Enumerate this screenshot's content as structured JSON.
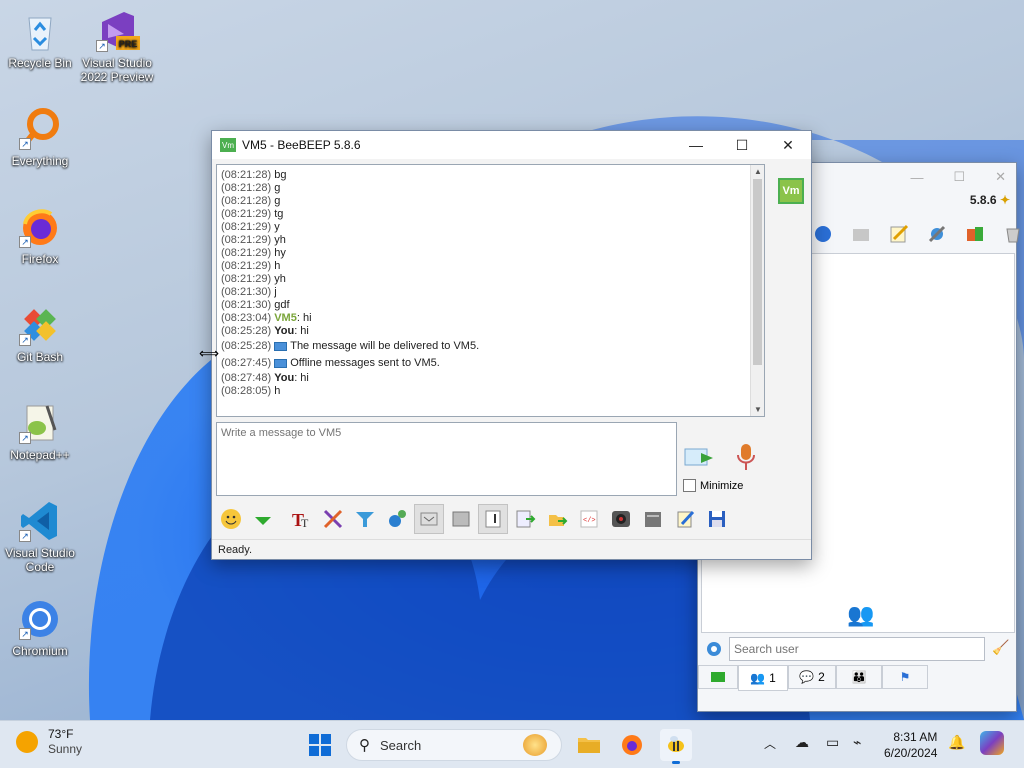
{
  "desktop": {
    "icons": [
      {
        "label": "Recycle Bin"
      },
      {
        "label": "Visual Studio 2022 Preview",
        "badge": "PRE"
      },
      {
        "label": "Everything"
      },
      {
        "label": "Firefox"
      },
      {
        "label": "Git Bash"
      },
      {
        "label": "Notepad++"
      },
      {
        "label": "Visual Studio Code"
      },
      {
        "label": "Chromium"
      }
    ]
  },
  "chat_window": {
    "title": "VM5 - BeeBEEP 5.8.6",
    "avatar": "Vm",
    "messages": [
      {
        "ts": "(08:21:28)",
        "text": "bg"
      },
      {
        "ts": "(08:21:28)",
        "text": "g"
      },
      {
        "ts": "(08:21:28)",
        "text": "g"
      },
      {
        "ts": "(08:21:29)",
        "text": "tg"
      },
      {
        "ts": "(08:21:29)",
        "text": "y"
      },
      {
        "ts": "(08:21:29)",
        "text": "yh"
      },
      {
        "ts": "(08:21:29)",
        "text": "hy"
      },
      {
        "ts": "(08:21:29)",
        "text": "h"
      },
      {
        "ts": "(08:21:29)",
        "text": "yh"
      },
      {
        "ts": "(08:21:30)",
        "text": "j"
      },
      {
        "ts": "(08:21:30)",
        "text": "gdf"
      },
      {
        "ts": "(08:23:04)",
        "sender": "VM5",
        "text": ": hi"
      },
      {
        "ts": "(08:25:28)",
        "sender": "You",
        "text": ": hi"
      },
      {
        "ts": "(08:25:28)",
        "system": true,
        "text": "The message will be delivered to VM5."
      },
      {
        "ts": "(08:27:45)",
        "system": true,
        "text": "Offline messages sent to VM5."
      },
      {
        "ts": "(08:27:48)",
        "sender": "You",
        "text": ": hi"
      },
      {
        "ts": "(08:28:05)",
        "text": "h"
      }
    ],
    "input_placeholder": "Write a message to VM5",
    "minimize_label": "Minimize",
    "status": "Ready."
  },
  "main_window": {
    "version": "5.8.6",
    "search_placeholder": "Search user",
    "tabs": [
      {
        "count": "1"
      },
      {
        "count": "2"
      }
    ]
  },
  "taskbar": {
    "weather_temp": "73°F",
    "weather_desc": "Sunny",
    "search_label": "Search",
    "time": "8:31 AM",
    "date": "6/20/2024"
  },
  "colors": {
    "accent": "#1a73e8",
    "vm_green": "#7aa53a",
    "taskbar": "#dfe7f1"
  }
}
